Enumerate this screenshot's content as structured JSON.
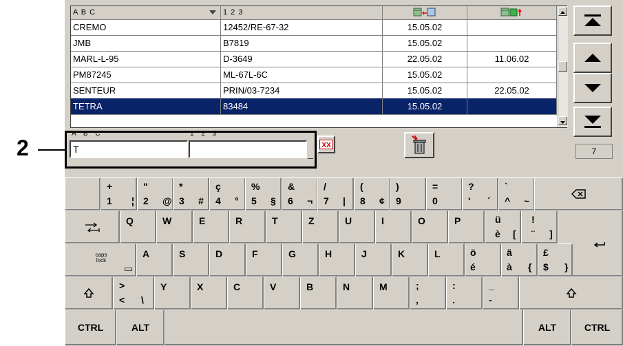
{
  "callout_label": "2",
  "table": {
    "headers": [
      "A B C",
      "1 2 3"
    ],
    "rows": [
      {
        "name": "CREMO",
        "code": "12452/RE-67-32",
        "date1": "15.05.02",
        "date2": ""
      },
      {
        "name": "JMB",
        "code": "B7819",
        "date1": "15.05.02",
        "date2": ""
      },
      {
        "name": "MARL-L-95",
        "code": "D-3649",
        "date1": "22.05.02",
        "date2": "11.06.02"
      },
      {
        "name": "PM87245",
        "code": "ML-67L-6C",
        "date1": "15.05.02",
        "date2": ""
      },
      {
        "name": "SENTEUR",
        "code": "PRIN/03-7234",
        "date1": "15.05.02",
        "date2": "22.05.02"
      },
      {
        "name": "TETRA",
        "code": "83484",
        "date1": "15.05.02",
        "date2": ""
      }
    ],
    "selected_row": "TETRA"
  },
  "record_count": "7",
  "inputs": {
    "name_label": "A B C",
    "code_label": "1 2 3",
    "name_value": "T",
    "code_value": ""
  },
  "keyboard": {
    "row1": [
      {
        "top": "+",
        "bot": "1",
        "alt": ""
      },
      {
        "top": "\"",
        "bot": "2",
        "alt": "@"
      },
      {
        "top": "*",
        "bot": "3",
        "alt": "#"
      },
      {
        "top": "ç",
        "bot": "4",
        "alt": "°"
      },
      {
        "top": "%",
        "bot": "5",
        "alt": "§"
      },
      {
        "top": "&",
        "bot": "6",
        "alt": "¬"
      },
      {
        "top": "/",
        "bot": "7",
        "alt": "|"
      },
      {
        "top": "(",
        "bot": "8",
        "alt": "¢"
      },
      {
        "top": ")",
        "bot": "9",
        "alt": ""
      },
      {
        "top": "=",
        "bot": "0",
        "alt": ""
      },
      {
        "top": "?",
        "bot": "'",
        "alt": "´"
      },
      {
        "top": "`",
        "bot": "^",
        "alt": "~"
      }
    ],
    "row1_first_alt": "¦",
    "row2": [
      "Q",
      "W",
      "E",
      "R",
      "T",
      "Z",
      "U",
      "I",
      "O",
      "P"
    ],
    "row2_extra": [
      {
        "top": "ü",
        "bot": "è",
        "alt": "["
      },
      {
        "top": "!",
        "bot": "¨",
        "alt": "]"
      }
    ],
    "row3": [
      "A",
      "S",
      "D",
      "F",
      "G",
      "H",
      "J",
      "K",
      "L"
    ],
    "row3_extra": [
      {
        "top": "ö",
        "bot": "é",
        "alt": ""
      },
      {
        "top": "ä",
        "bot": "à",
        "alt": "{"
      },
      {
        "top": "£",
        "bot": "$",
        "alt": "}"
      }
    ],
    "row4_lt": {
      "top": ">",
      "bot": "<",
      "alt": "\\"
    },
    "row4": [
      "Y",
      "X",
      "C",
      "V",
      "B",
      "N",
      "M"
    ],
    "row4_extra": [
      {
        "top": ";",
        "bot": ","
      },
      {
        "top": ":",
        "bot": "."
      },
      {
        "top": "_",
        "bot": "-"
      }
    ],
    "caps_label": "caps lock",
    "ctrl": "CTRL",
    "alt": "ALT"
  }
}
